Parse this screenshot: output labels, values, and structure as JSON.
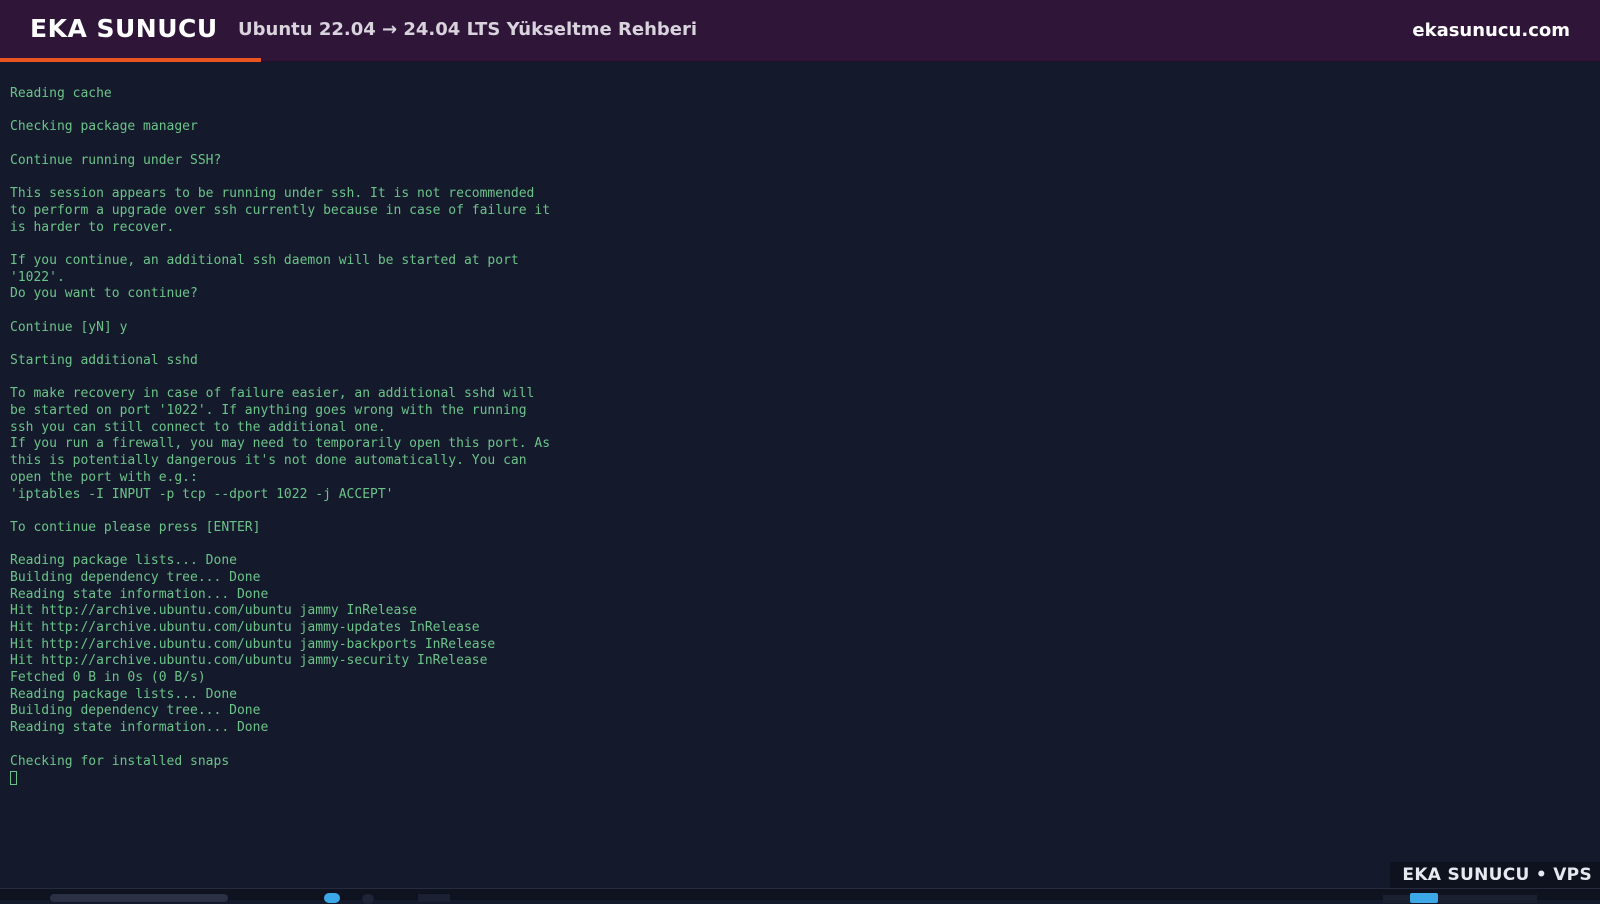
{
  "header": {
    "brand": "EKA SUNUCU",
    "title": "Ubuntu 22.04 → 24.04 LTS Yükseltme Rehberi",
    "site": "ekasunucu.com",
    "progress_percent": 16.3,
    "accent_color": "#e95420"
  },
  "terminal": {
    "lines": [
      "Reading cache",
      "",
      "Checking package manager",
      "",
      "Continue running under SSH?",
      "",
      "This session appears to be running under ssh. It is not recommended",
      "to perform a upgrade over ssh currently because in case of failure it",
      "is harder to recover.",
      "",
      "If you continue, an additional ssh daemon will be started at port",
      "'1022'.",
      "Do you want to continue?",
      "",
      "Continue [yN] y",
      "",
      "Starting additional sshd",
      "",
      "To make recovery in case of failure easier, an additional sshd will",
      "be started on port '1022'. If anything goes wrong with the running",
      "ssh you can still connect to the additional one.",
      "If you run a firewall, you may need to temporarily open this port. As",
      "this is potentially dangerous it's not done automatically. You can",
      "open the port with e.g.:",
      "'iptables -I INPUT -p tcp --dport 1022 -j ACCEPT'",
      "",
      "To continue please press [ENTER]",
      "",
      "Reading package lists... Done",
      "Building dependency tree... Done",
      "Reading state information... Done",
      "Hit http://archive.ubuntu.com/ubuntu jammy InRelease",
      "Hit http://archive.ubuntu.com/ubuntu jammy-updates InRelease",
      "Hit http://archive.ubuntu.com/ubuntu jammy-backports InRelease",
      "Hit http://archive.ubuntu.com/ubuntu jammy-security InRelease",
      "Fetched 0 B in 0s (0 B/s)",
      "Reading package lists... Done",
      "Building dependency tree... Done",
      "Reading state information... Done",
      "",
      "Checking for installed snaps"
    ],
    "text_color": "#6cc38a",
    "background_color": "#141a2b"
  },
  "watermark": {
    "text": "EKA SUNUCU • VPS"
  }
}
